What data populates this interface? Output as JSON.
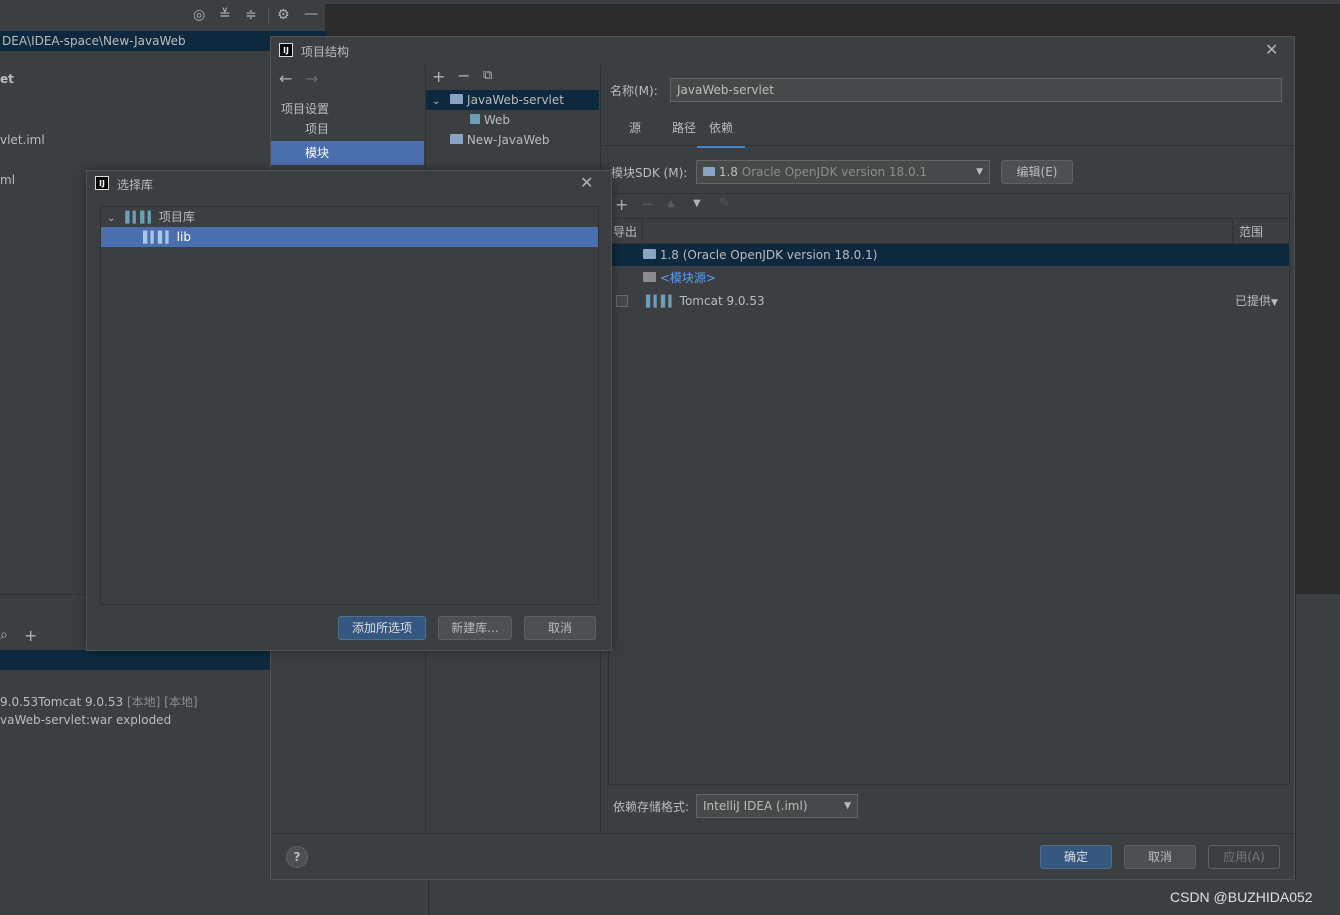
{
  "background_ide": {
    "path": "DEA\\IDEA-space\\New-JavaWeb",
    "tree_items": [
      "et",
      "vlet.iml",
      "ml"
    ],
    "run_line1_main": "9.0.53Tomcat 9.0.53",
    "run_line1_tag1": "[本地]",
    "run_line1_tag2": "[本地]",
    "run_line2": "vaWeb-servlet:war exploded"
  },
  "project_structure": {
    "title": "项目结构",
    "nav": {
      "back_icon": "arrow-left-icon",
      "forward_icon": "arrow-right-icon",
      "section": "项目设置",
      "items": [
        "项目",
        "模块"
      ],
      "selected": "模块"
    },
    "modules": {
      "toolbar": [
        "add-icon",
        "remove-icon",
        "copy-icon"
      ],
      "items": [
        {
          "name": "JavaWeb-servlet",
          "child": "Web"
        },
        {
          "name": "New-JavaWeb"
        }
      ]
    },
    "name_label": "名称(M):",
    "name_value": "JavaWeb-servlet",
    "tabs": [
      "源",
      "路径",
      "依赖"
    ],
    "active_tab": "依赖",
    "sdk_label": "模块SDK (M):",
    "sdk_version": "1.8",
    "sdk_desc": "Oracle OpenJDK version 18.0.1",
    "edit_button": "编辑(E)",
    "deps_header": {
      "export": "导出",
      "scope": "范围"
    },
    "deps": [
      {
        "name": "1.8 (Oracle OpenJDK version 18.0.1)",
        "scope": ""
      },
      {
        "name": "<模块源>",
        "scope": ""
      },
      {
        "name": "Tomcat 9.0.53",
        "scope": "已提供"
      }
    ],
    "storage_label": "依赖存储格式:",
    "storage_value": "IntelliJ IDEA (.iml)",
    "help": "?",
    "ok": "确定",
    "cancel": "取消",
    "apply": "应用(A)"
  },
  "choose_library": {
    "title": "选择库",
    "group": "项目库",
    "item": "lib",
    "add_selected": "添加所选项",
    "new_library": "新建库...",
    "cancel": "取消"
  },
  "watermark": "CSDN @BUZHIDA052",
  "colors": {
    "selection": "#4b6eaf",
    "dark_selection": "#0d293e",
    "primary_button": "#365880"
  }
}
